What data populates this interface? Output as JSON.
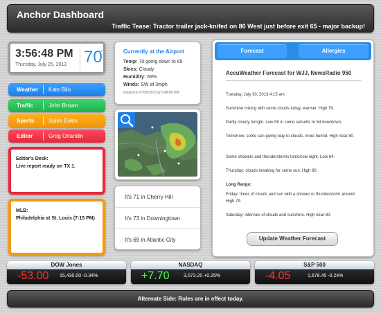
{
  "header": {
    "title": "Anchor Dashboard",
    "traffic_tease": "Traffic Tease: Tractor trailer jack-knifed on 80 West just before exit 65 - major backup!"
  },
  "clock": {
    "time": "3:56:48 PM",
    "date": "Thursday, July 25, 2013",
    "temperature": "70",
    "temperature_unit": "°"
  },
  "staff": [
    {
      "role": "Weather",
      "name": "Kate Bilo",
      "color": "#1f7ee6"
    },
    {
      "role": "Traffic",
      "name": "John Brown",
      "color": "#20b04c"
    },
    {
      "role": "Sports",
      "name": "Spike Eskin",
      "color": "#f2940b"
    },
    {
      "role": "Editor",
      "name": "Greg Orlandin",
      "color": "#e22a3c"
    }
  ],
  "editor_desk": {
    "title": "Editor's Desk:",
    "message": "Live report ready on TX 1."
  },
  "mlb": {
    "title": "MLB:",
    "game": "Philadelphia at St. Louis (7:15 PM)"
  },
  "airport": {
    "title": "Currently at the Airport",
    "rows": [
      {
        "label": "Temp:",
        "value": "70 going down to 65"
      },
      {
        "label": "Skies:",
        "value": "Cloudy"
      },
      {
        "label": "Humidity:",
        "value": "69%"
      },
      {
        "label": "Winds:",
        "value": "SW at 3mph"
      }
    ],
    "issued": "Issued on 07/25/2013 at 3:48:00 PM"
  },
  "radar": {
    "icon": "search-icon"
  },
  "local_temps": [
    "It's 71 in Cherry Hill",
    "It's 73 in Downingtown",
    "It's 69 in Atlantic City"
  ],
  "forecast": {
    "tabs": [
      "Forecast",
      "Allergies"
    ],
    "title": "AccuWeather Forecast for WJJ, NewsRadio 950",
    "timestamp": "Tuesday, July 30, 2013 4:15 am",
    "paragraphs": [
      "Sunshine mixing with some clouds today, warmer. High 79.",
      "Partly cloudy tonight. Low 59 in some suburbs to 64 downtown.",
      "Tomorrow: some sun giving way to clouds, more humid. High near 80.",
      "Some showers and thunderstorms tomorrow night. Low 64.",
      "Thursday: clouds breaking for some sun. High 80."
    ],
    "long_range_label": "Long Range:",
    "long_range": [
      "Friday: times of clouds and sun with a shower or thunderstorm around. High 79.",
      "Saturday: intervals of clouds and sunshine. High near 80."
    ],
    "update_button": "Update Weather Forecast"
  },
  "stocks": [
    {
      "name": "DOW Jones",
      "change": "-53.00",
      "level": "15,430.00 -0.34%",
      "color": "#ff3030"
    },
    {
      "name": "NASDAQ",
      "change": "+7.70",
      "level": "3,073.20 +0.25%",
      "color": "#4cff4c"
    },
    {
      "name": "S&P 500",
      "change": "-4.05",
      "level": "1,678.45 -0.24%",
      "color": "#ff3030"
    }
  ],
  "footer": {
    "alternate_side": "Alternate Side: Rules are in effect today."
  }
}
